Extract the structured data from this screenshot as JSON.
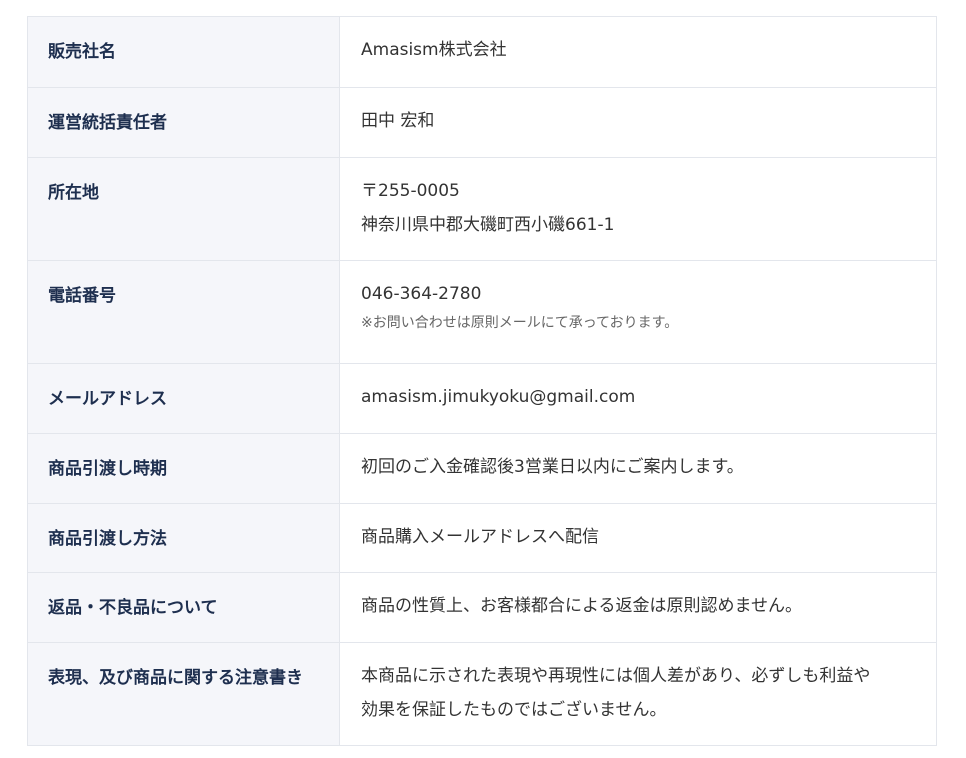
{
  "rows": [
    {
      "label": "販売社名",
      "lines": [
        "Amasism株式会社"
      ]
    },
    {
      "label": "運営統括責任者",
      "lines": [
        "田中 宏和"
      ]
    },
    {
      "label": "所在地",
      "lines": [
        "〒255-0005",
        "神奈川県中郡大磯町西小磯661-1"
      ]
    },
    {
      "label": "電話番号",
      "lines": [
        "046-364-2780"
      ],
      "note": "※お問い合わせは原則メールにて承っております。"
    },
    {
      "label": "メールアドレス",
      "lines": [
        "amasism.jimukyoku@gmail.com"
      ]
    },
    {
      "label": "商品引渡し時期",
      "lines": [
        "初回のご入金確認後3営業日以内にご案内します。"
      ]
    },
    {
      "label": "商品引渡し方法",
      "lines": [
        "商品購入メールアドレスへ配信"
      ]
    },
    {
      "label": "返品・不良品について",
      "lines": [
        "商品の性質上、お客様都合による返金は原則認めません。"
      ]
    },
    {
      "label": "表現、及び商品に関する注意書き",
      "lines": [
        "本商品に示された表現や再現性には個人差があり、必ずしも利益や",
        "効果を保証したものではございません。"
      ]
    }
  ]
}
